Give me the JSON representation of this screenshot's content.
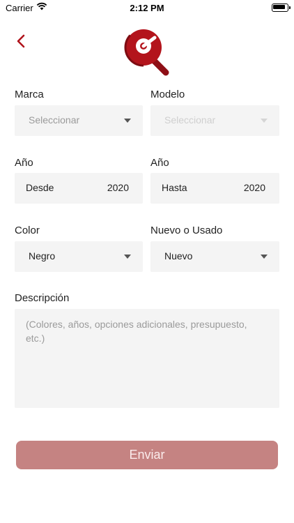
{
  "status_bar": {
    "carrier": "Carrier",
    "time": "2:12 PM"
  },
  "header": {
    "back_icon": "chevron-left-icon",
    "logo_icon": "search-magnifier-logo"
  },
  "form": {
    "marca": {
      "label": "Marca",
      "value": "Seleccionar"
    },
    "modelo": {
      "label": "Modelo",
      "value": "Seleccionar"
    },
    "anio_desde": {
      "label": "Año",
      "text": "Desde",
      "value": "2020"
    },
    "anio_hasta": {
      "label": "Año",
      "text": "Hasta",
      "value": "2020"
    },
    "color": {
      "label": "Color",
      "value": "Negro"
    },
    "condicion": {
      "label": "Nuevo o Usado",
      "value": "Nuevo"
    },
    "descripcion": {
      "label": "Descripción",
      "placeholder": "(Colores, años, opciones adicionales, presupuesto, etc.)"
    }
  },
  "submit": {
    "label": "Enviar"
  },
  "colors": {
    "accent": "#b0141c",
    "button": "#c58382",
    "field_bg": "#f4f4f4"
  }
}
